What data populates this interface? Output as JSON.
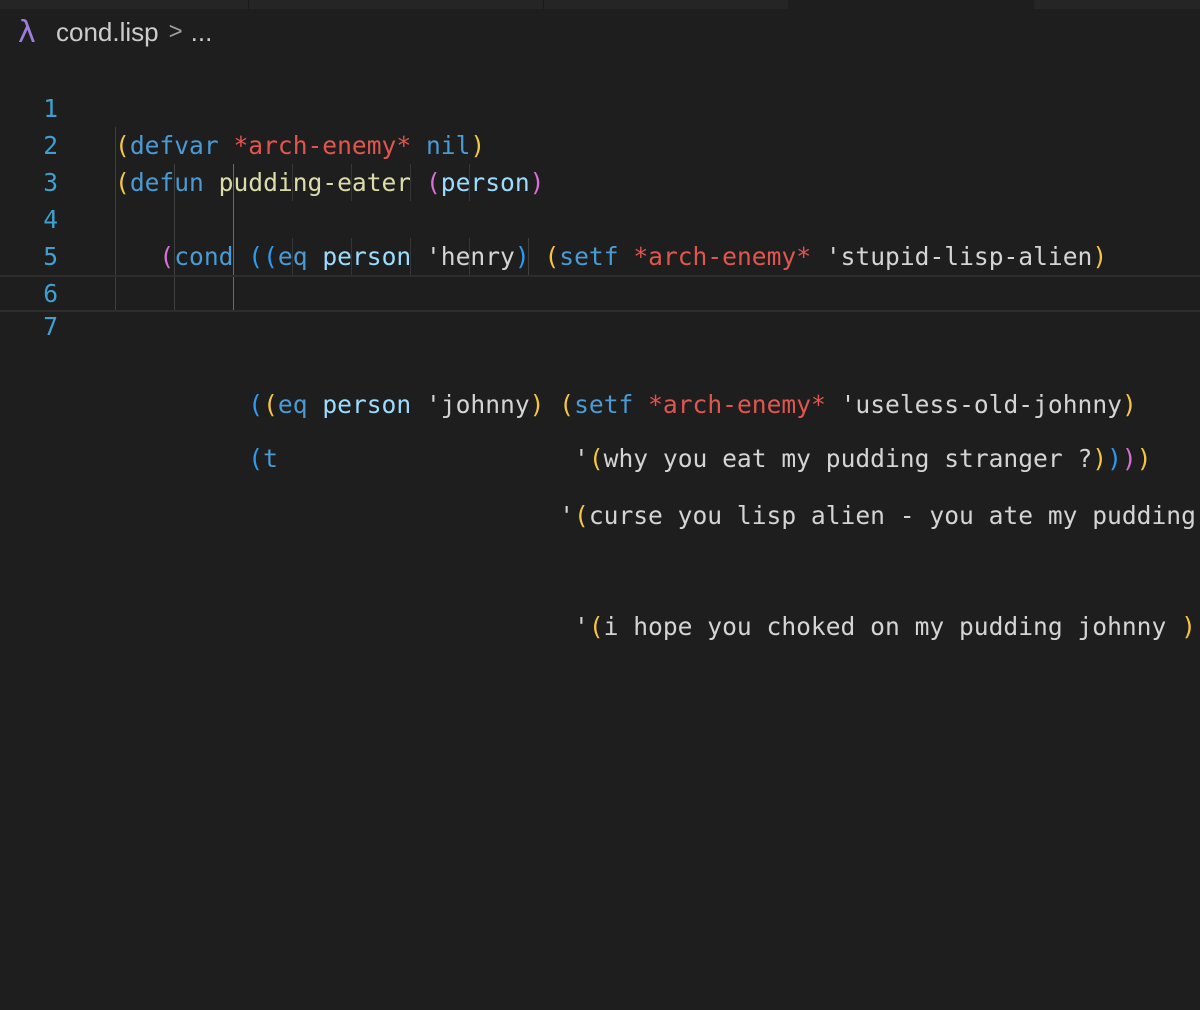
{
  "breadcrumb": {
    "file": "cond.lisp",
    "separator": ">",
    "more": "...",
    "file_icon": "lambda-icon"
  },
  "colors": {
    "background": "#1e1e1e",
    "line_number": "#3fa0cf",
    "bracket_gold": "#f5c542",
    "bracket_magenta": "#d670d6",
    "bracket_blue": "#2d9cf0",
    "keyword": "#4a9ad4",
    "special_variable": "#e0564f",
    "function_name": "#dcdcaa",
    "identifier": "#9cdcfe",
    "text": "#d4d4d4"
  },
  "editor": {
    "current_line": 7,
    "lines": [
      {
        "number": "1",
        "text": "(defvar *arch-enemy* nil)"
      },
      {
        "number": "2",
        "text": "(defun pudding-eater (person)"
      },
      {
        "number": "3",
        "text": "   (cond ((eq person 'henry) (setf *arch-enemy* 'stupid-lisp-alien)"
      },
      {
        "number": "4",
        "text": "                              '(curse you lisp alien - you ate my pudding))"
      },
      {
        "number": "5",
        "text": "         ((eq person 'johnny) (setf *arch-enemy* 'useless-old-johnny)"
      },
      {
        "number": "6",
        "text": "                               '(i hope you choked on my pudding johnny ))"
      },
      {
        "number": "7",
        "text": "         (t                    '(why you eat my pudding stranger ?))))"
      }
    ]
  }
}
